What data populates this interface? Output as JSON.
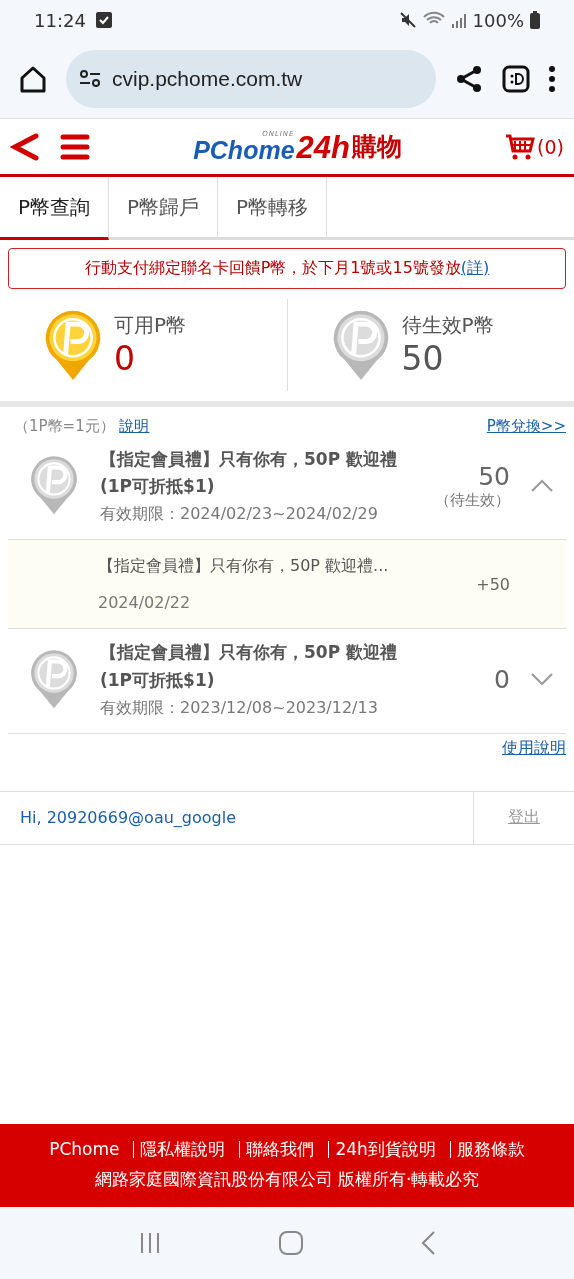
{
  "status_bar": {
    "time": "11:24",
    "battery": "100%"
  },
  "browser": {
    "url": "cvip.pchome.com.tw"
  },
  "site_header": {
    "logo": {
      "brand": "PChome",
      "tag": "ONLINE",
      "number": "24h",
      "suffix": "購物"
    },
    "cart_count": "(0)"
  },
  "tabs": [
    {
      "label": "P幣查詢",
      "selected": true
    },
    {
      "label": "P幣歸戶",
      "selected": false
    },
    {
      "label": "P幣轉移",
      "selected": false
    }
  ],
  "notice": {
    "text": "行動支付綁定聯名卡回饋P幣，於下月1號或15號發放",
    "link": "(詳)"
  },
  "balances": [
    {
      "kind": "available",
      "label": "可用P幣",
      "amount": "0"
    },
    {
      "kind": "pending",
      "label": "待生效P幣",
      "amount": "50"
    }
  ],
  "info_row": {
    "rate": "（1P幣=1元）",
    "help_link": "說明",
    "exchange_link": "P幣兌換>>"
  },
  "entries": [
    {
      "title": "【指定會員禮】只有你有，50P 歡迎禮(1P可折抵$1)",
      "validity": "有效期限：2024/02/23~2024/02/29",
      "points": "50",
      "status": "（待生效）",
      "expanded": true,
      "history": [
        {
          "title": "【指定會員禮】只有你有，50P 歡迎禮...",
          "date": "2024/02/22",
          "change": "+50"
        }
      ]
    },
    {
      "title": "【指定會員禮】只有你有，50P 歡迎禮(1P可折抵$1)",
      "validity": "有效期限：2023/12/08~2023/12/13",
      "points": "0",
      "expanded": false
    }
  ],
  "usage_link": "使用說明",
  "user_bar": {
    "greeting": "Hi, 20920669@oau_google",
    "logout": "登出"
  },
  "footer": {
    "links": [
      "PChome",
      "隱私權說明",
      "聯絡我們",
      "24h到貨說明",
      "服務條款"
    ],
    "copyright": "網路家庭國際資訊股份有限公司 版權所有‧轉載必究"
  }
}
